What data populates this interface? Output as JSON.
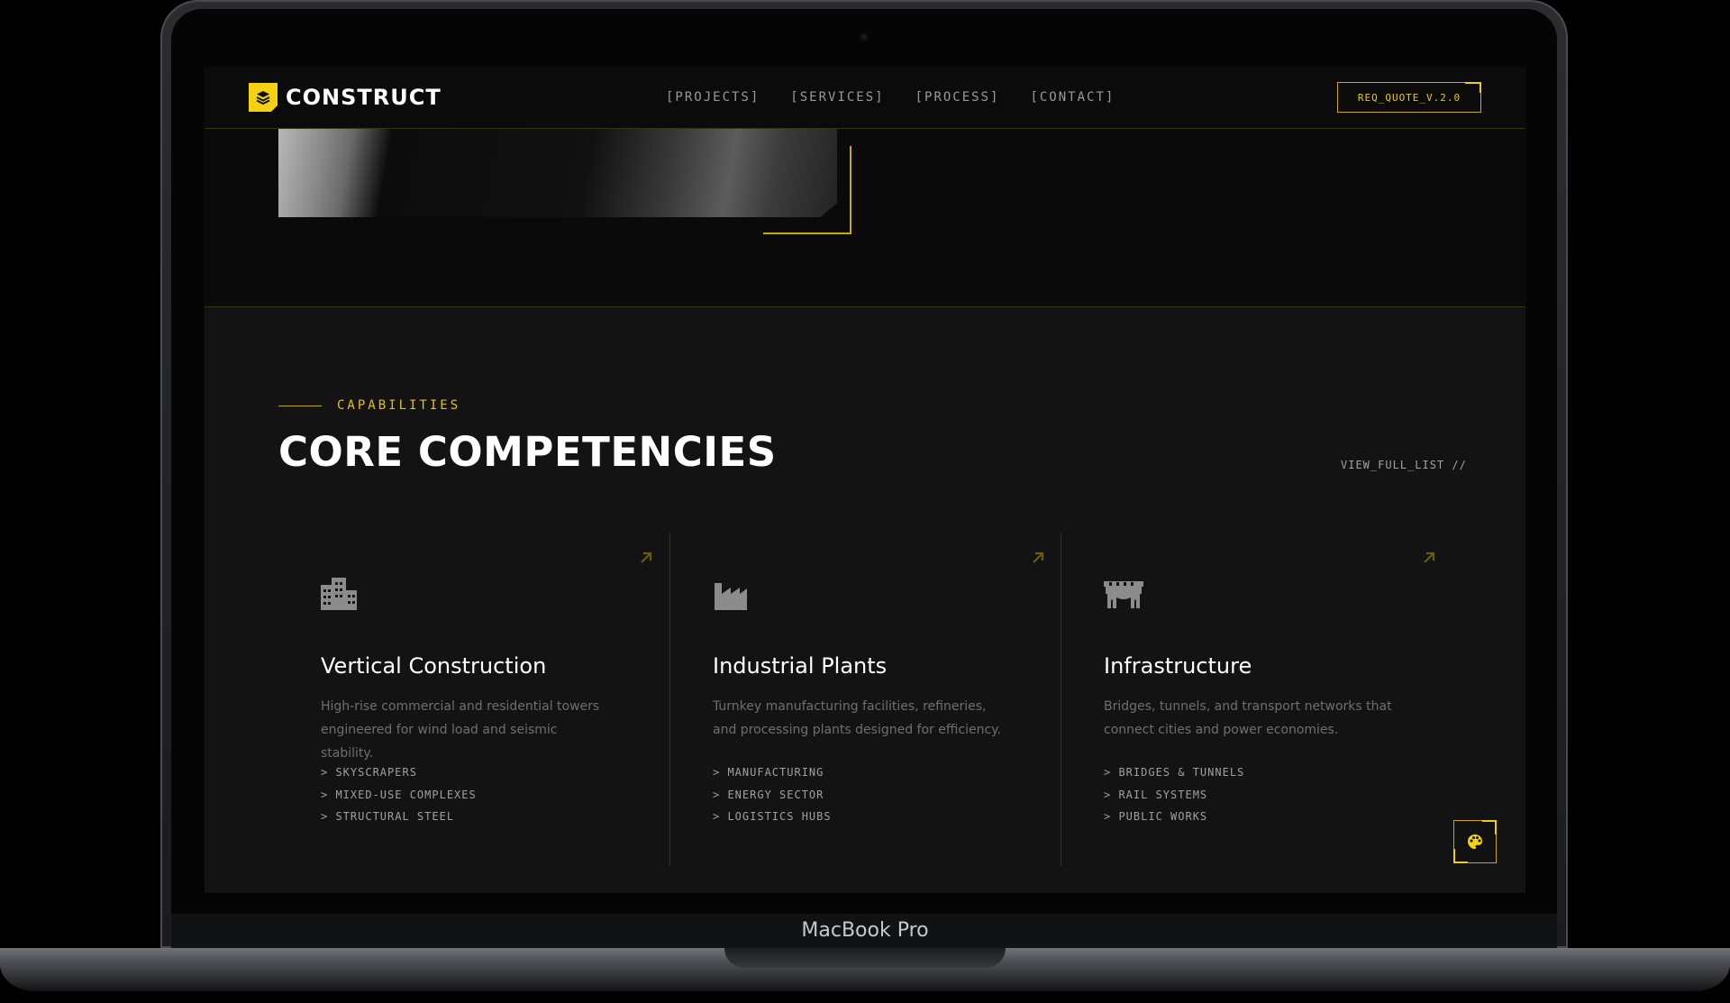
{
  "device": {
    "label": "MacBook Pro"
  },
  "nav": {
    "brand": "CONSTRUCT",
    "links": [
      "[PROJECTS]",
      "[SERVICES]",
      "[PROCESS]",
      "[CONTACT]"
    ],
    "cta": "REQ_QUOTE_V.2.0"
  },
  "section": {
    "eyebrow": "CAPABILITIES",
    "title": "CORE COMPETENCIES",
    "view_all": "VIEW_FULL_LIST //"
  },
  "cards": [
    {
      "icon": "city-buildings-icon",
      "title": "Vertical Construction",
      "desc": "High-rise commercial and residential towers engineered for wind load and seismic stability.",
      "items": [
        "> SKYSCRAPERS",
        "> MIXED-USE COMPLEXES",
        "> STRUCTURAL STEEL"
      ]
    },
    {
      "icon": "factory-icon",
      "title": "Industrial Plants",
      "desc": "Turnkey manufacturing facilities, refineries, and processing plants designed for efficiency.",
      "items": [
        "> MANUFACTURING",
        "> ENERGY SECTOR",
        "> LOGISTICS HUBS"
      ]
    },
    {
      "icon": "bridge-icon",
      "title": "Infrastructure",
      "desc": "Bridges, tunnels, and transport networks that connect cities and power economies.",
      "items": [
        "> BRIDGES & TUNNELS",
        "> RAIL SYSTEMS",
        "> PUBLIC WORKS"
      ]
    }
  ],
  "colors": {
    "accent": "#f5d20f",
    "background": "#131313",
    "divider": "#3a3413"
  }
}
